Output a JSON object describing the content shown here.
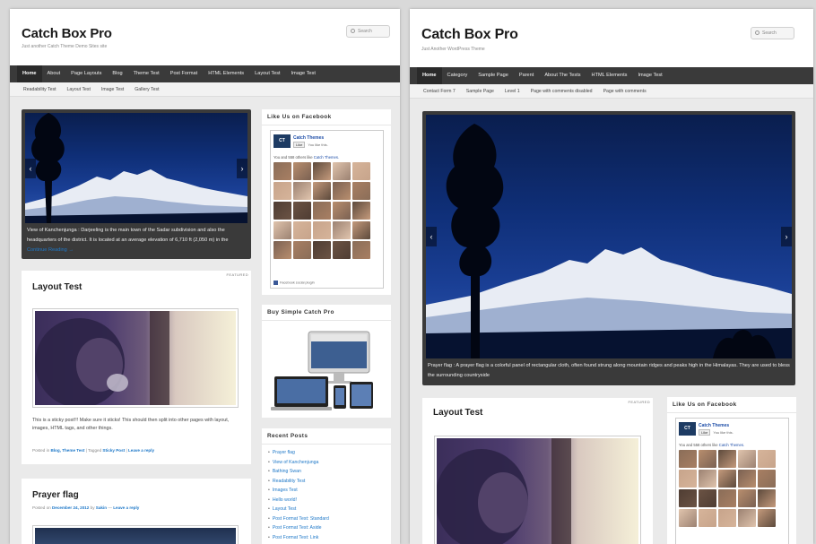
{
  "left": {
    "site_title": "Catch Box Pro",
    "site_desc": "Just another Catch Theme Demo Sites site",
    "search_placeholder": "Search",
    "nav": [
      "Home",
      "About",
      "Page Layouts",
      "Blog",
      "Theme Test",
      "Post Format",
      "HTML Elements",
      "Layout Test",
      "Image Test"
    ],
    "subnav": [
      "Readability Test",
      "Layout Test",
      "Image Test",
      "Gallery Test"
    ],
    "slider_caption": "View of Kanchenjunga : Darjeeling is the main town of the Sadar subdivision and also the headquarters of the district. It is located at an average elevation of 6,710 ft (2,050 m) in the",
    "slider_more": "Continue Reading →",
    "post1": {
      "featured": "FEATURED",
      "title": "Layout Test",
      "excerpt": "This is a sticky post!!! Make sure it sticks! This should then split into other pages with layout, images, HTML tags, and other things.",
      "meta_posted": "Posted in",
      "meta_cats": "Blog, Theme Test",
      "meta_tagged": "| Tagged",
      "meta_tag": "Sticky Post",
      "meta_sep": "|",
      "meta_reply": "Leave a reply"
    },
    "post2": {
      "title": "Prayer flag",
      "meta_on": "Posted on",
      "meta_date": "December 24, 2012",
      "meta_by": "by",
      "meta_author": "Sakin",
      "meta_dash": "—",
      "meta_reply": "Leave a reply"
    },
    "widget_fb": {
      "title": "Like Us on Facebook",
      "page_name": "Catch Themes",
      "like_btn": "Like",
      "like_text": "You like this.",
      "count_pre": "You and 558 others like",
      "count_link": "Catch Themes.",
      "footer": "Facebook social plugin",
      "logo_text": "CT"
    },
    "widget_buy": {
      "title": "Buy Simple Catch Pro"
    },
    "widget_recent": {
      "title": "Recent Posts",
      "items": [
        "Prayer flag",
        "View of Kanchenjunga",
        "Bathing Swan",
        "Readability Test",
        "Images Test",
        "Hello world!",
        "Layout Test",
        "Post Format Test: Standard",
        "Post Format Test: Aside",
        "Post Format Test: Link"
      ]
    }
  },
  "right": {
    "site_title": "Catch Box Pro",
    "site_desc": "Just Another WordPress Theme",
    "search_placeholder": "Search",
    "nav": [
      "Home",
      "Category",
      "Sample Page",
      "Parent",
      "About The Tests",
      "HTML Elements",
      "Image Test"
    ],
    "subnav": [
      "Contact Form 7",
      "Sample Page",
      "Level 1",
      "Page with comments disabled",
      "Page with comments"
    ],
    "slider_caption": "Prayer flag : A prayer flag is a colorful panel of rectangular cloth, often found strung along mountain ridges and peaks high in the Himalayas. They are used to bless the surrounding countryside",
    "post1": {
      "featured": "FEATURED",
      "title": "Layout Test"
    },
    "widget_fb": {
      "title": "Like Us on Facebook",
      "page_name": "Catch Themes",
      "like_btn": "Like",
      "like_text": "You like this.",
      "count_pre": "You and 558 others like",
      "count_link": "Catch Themes.",
      "logo_text": "CT"
    }
  },
  "colors": {
    "nav_bg": "#3a3a3a",
    "link": "#1e78c8",
    "sky_dark": "#0a1e4e",
    "facebook_blue": "#3b5998"
  }
}
